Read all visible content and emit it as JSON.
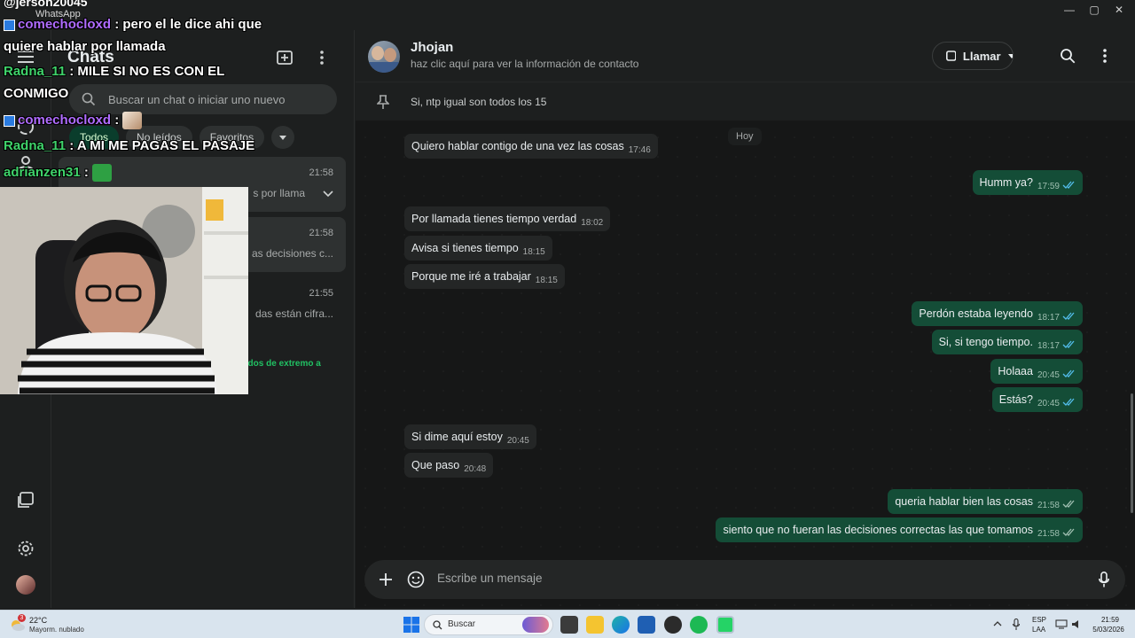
{
  "window": {
    "app_title": "WhatsApp",
    "minimize": "—",
    "maximize": "▢",
    "close": "✕"
  },
  "chats_panel": {
    "title": "Chats",
    "search_placeholder": "Buscar un chat o iniciar uno nuevo",
    "filters": [
      "Todos",
      "No leídos",
      "Favoritos"
    ],
    "items": [
      {
        "time": "21:58",
        "preview": "s por llama"
      },
      {
        "time": "21:58",
        "preview": "as decisiones c..."
      },
      {
        "time": "21:55",
        "preview": "das están cifra..."
      }
    ],
    "e2e_note": "ados de extremo a"
  },
  "conversation": {
    "contact_name": "Jhojan",
    "contact_subtitle": "haz clic aquí para ver la información de contacto",
    "call_label": "Llamar",
    "pinned_message": "Si, ntp igual son todos los 15",
    "day_label": "Hoy",
    "messages": [
      {
        "dir": "in",
        "text": "Quiero hablar contigo de una vez las cosas",
        "time": "17:46"
      },
      {
        "dir": "out",
        "text": "Humm ya?",
        "time": "17:59"
      },
      {
        "dir": "in",
        "text": "Por llamada tienes tiempo verdad",
        "time": "18:02"
      },
      {
        "dir": "in",
        "text": "Avisa si tienes tiempo",
        "time": "18:15"
      },
      {
        "dir": "in",
        "text": "Porque me iré a trabajar",
        "time": "18:15"
      },
      {
        "dir": "out",
        "text": "Perdón estaba leyendo",
        "time": "18:17"
      },
      {
        "dir": "out",
        "text": "Si, si tengo tiempo.",
        "time": "18:17"
      },
      {
        "dir": "out",
        "text": "Holaaa",
        "time": "20:45"
      },
      {
        "dir": "out",
        "text": "Estás?",
        "time": "20:45"
      },
      {
        "dir": "in",
        "text": "Si dime aquí estoy",
        "time": "20:45"
      },
      {
        "dir": "in",
        "text": "Que paso",
        "time": "20:48"
      },
      {
        "dir": "out",
        "text": "queria hablar bien las cosas",
        "time": "21:58"
      },
      {
        "dir": "out",
        "text": "siento que no fueran las decisiones correctas las que tomamos",
        "time": "21:58"
      }
    ],
    "composer_placeholder": "Escribe un mensaje"
  },
  "overlay": {
    "handle": "@jerson20045",
    "chat": [
      {
        "user": "comechocloxd",
        "text": ": pero el le dice ahi que"
      },
      {
        "user": "",
        "text": "quiere hablar por llamada"
      },
      {
        "user": "Radna_11",
        "text": ": MILE SI NO ES CON EL"
      },
      {
        "user": "",
        "text": "CONMIGO"
      },
      {
        "user": "comechocloxd",
        "text": ":"
      },
      {
        "user": "Radna_11",
        "text": ": A MI ME PAGAS EL PASAJE"
      },
      {
        "user": "adrianzen31",
        "text": ":"
      }
    ]
  },
  "taskbar": {
    "weather_badge": "3",
    "weather_temp": "22°C",
    "weather_desc": "Mayorm. nublado",
    "search_label": "Buscar",
    "lang_top": "ESP",
    "lang_bottom": "LAA",
    "time": "21:59",
    "date": "5/03/2026"
  },
  "colors": {
    "accent": "#21c063",
    "outgoing_bubble": "#144d37",
    "incoming_bubble": "#242626",
    "background": "#161717"
  }
}
